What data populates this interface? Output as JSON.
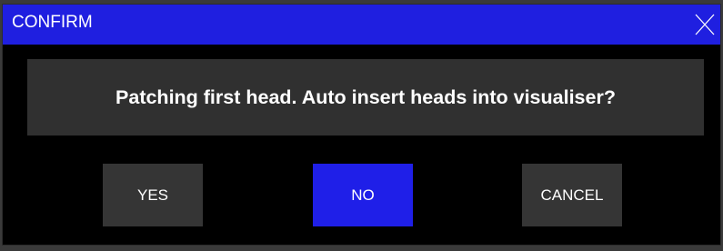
{
  "dialog": {
    "title": "CONFIRM",
    "close_icon": "close-icon",
    "message": "Patching first head. Auto insert heads into visualiser?",
    "buttons": {
      "yes": "YES",
      "no": "NO",
      "cancel": "CANCEL"
    },
    "selected_button": "no"
  },
  "colors": {
    "titlebar": "#1f1fe0",
    "selected_button": "#1f1fe8",
    "button": "#353535",
    "message_panel": "#303030",
    "background": "#000000",
    "text": "#ffffff"
  }
}
